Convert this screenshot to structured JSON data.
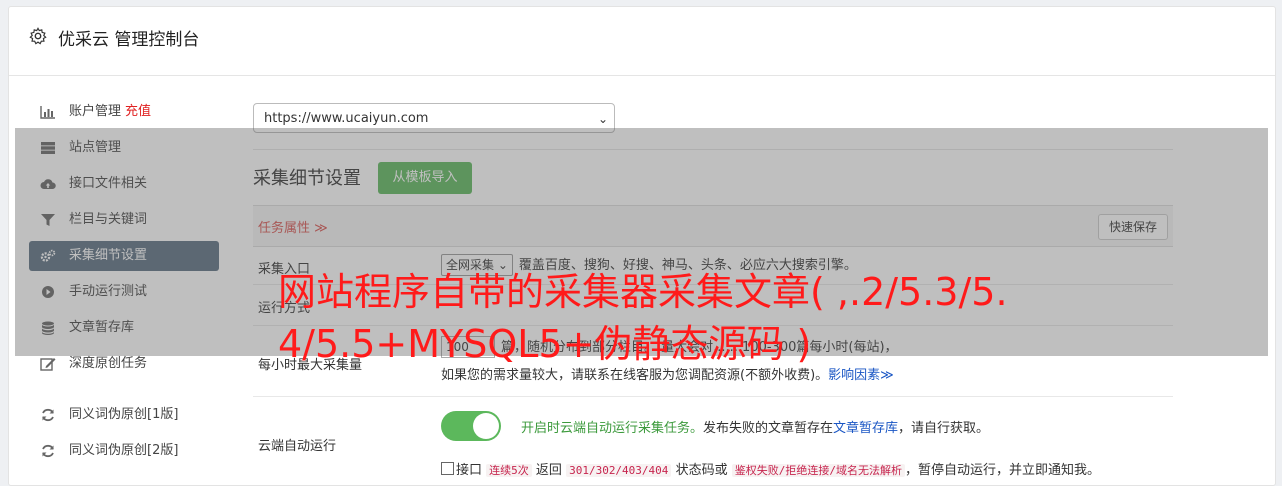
{
  "header": {
    "title": "优采云 管理控制台",
    "icon": "gear-icon"
  },
  "sidebar": {
    "items": [
      {
        "label": "账户管理",
        "extra": "充值",
        "icon": "bar-chart-icon",
        "active": false
      },
      {
        "label": "站点管理",
        "icon": "server-icon",
        "active": false
      },
      {
        "label": "接口文件相关",
        "icon": "cloud-upload-icon",
        "active": false
      },
      {
        "label": "栏目与关键词",
        "icon": "filter-icon",
        "active": false
      },
      {
        "label": "采集细节设置",
        "icon": "gears-icon",
        "active": true
      },
      {
        "label": "手动运行测试",
        "icon": "play-circle-icon",
        "active": false
      },
      {
        "label": "文章暂存库",
        "icon": "database-icon",
        "active": false
      },
      {
        "label": "深度原创任务",
        "icon": "edit-icon",
        "active": false
      }
    ],
    "items2": [
      {
        "label": "同义词伪原创[1版]",
        "icon": "refresh-icon"
      },
      {
        "label": "同义词伪原创[2版]",
        "icon": "refresh-icon"
      }
    ]
  },
  "main": {
    "site_select": "https://www.ucaiyun.com",
    "section_title": "采集细节设置",
    "import_button": "从模板导入",
    "tab_label": "任务属性 ≫",
    "quick_save": "快速保存",
    "rows": {
      "entry": {
        "label": "采集入口",
        "select": "全网采集",
        "desc": "覆盖百度、搜狗、好搜、神马、头条、必应六大搜索引擎。"
      },
      "run_mode": {
        "label": "运行方式"
      },
      "hourly": {
        "label": "每小时最大采集量",
        "value": "100",
        "line1": "篇，随机分布到部分栏目。 量大会对...... 100-300篇每小时(每站)，",
        "line2": "如果您的需求量较大，请联系在线客服为您调配资源(不额外收费)。",
        "link": "影响因素≫"
      },
      "cloud": {
        "label": "云端自动运行",
        "green_text": "开启时云端自动运行采集任务。",
        "text1": "发布失败的文章暂存在",
        "link": "文章暂存库",
        "text2": "，请自行获取。",
        "check_label": "接口",
        "code1": "连续5次",
        "mid1": "返回",
        "code2": "301/302/403/404",
        "mid2": "状态码或",
        "code3": "鉴权失败/拒绝连接/域名无法解析",
        "tail": "，暂停自动运行，并立即通知我。"
      }
    }
  },
  "watermark": "网站程序自带的采集器采集文章( ,.2/5.3/5.4/5.5+MYSQL5+伪静态源码 )",
  "colors": {
    "active_bg": "#5a6f80",
    "green": "#5cb85c",
    "watermark": "#ff1a1a",
    "tab_red": "#d9534f"
  }
}
